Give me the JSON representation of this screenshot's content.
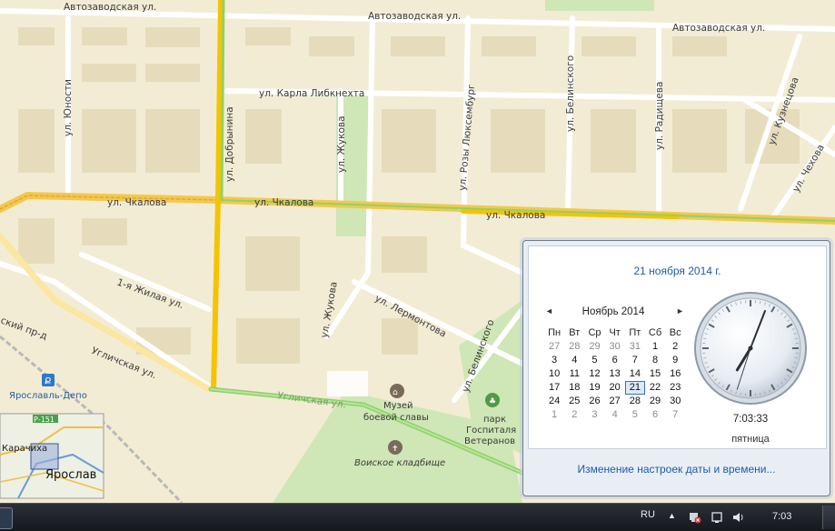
{
  "map": {
    "streets": {
      "avtozavodskaya_1": "Автозаводская ул.",
      "avtozavodskaya_2": "Автозаводская ул.",
      "avtozavodskaya_3": "Автозаводская ул.",
      "karla_libknekhta": "ул. Карла Либкнехта",
      "chkalova_1": "ул. Чкалова",
      "chkalova_2": "ул. Чкалова",
      "chkalova_3": "ул. Чкалова",
      "yunosti": "ул. Юности",
      "dobrynina": "ул. Добрынина",
      "zhukova_1": "ул. Жукова",
      "zhukova_2": "ул. Жукова",
      "rozy_lyuksemburg": "ул. Розы Люксембург",
      "belinskogo_1": "ул. Белинского",
      "belinskogo_2": "ул. Белинского",
      "radishcheva": "ул. Радищева",
      "kuznetsova": "ул. Кузнецова",
      "chekhova": "ул. Чехова",
      "zhilaya": "1-я Жилая ул.",
      "lermontova": "ул. Лермонтова",
      "uglichskaya_1": "Угличская ул.",
      "uglichskaya_2": "Угличская ул.",
      "yaroslavsky_pr": "ский пр-д"
    },
    "pois": {
      "station": "Ярославль-Депо",
      "museum_line1": "Музей",
      "museum_line2": "боевой славы",
      "park_line1": "парк",
      "park_line2": "Госпиталя",
      "park_line3": "Ветеранов",
      "cemetery": "Воиское кладбище"
    },
    "minimap": {
      "road_badge": "Р-151",
      "town": "Карачиха",
      "city": "Ярослав"
    }
  },
  "flyout": {
    "full_date": "21 ноября 2014 г.",
    "calendar": {
      "month_title": "Ноябрь 2014",
      "prev_label": "◄",
      "next_label": "►",
      "weekdays": [
        "Пн",
        "Вт",
        "Ср",
        "Чт",
        "Пт",
        "Сб",
        "Вс"
      ],
      "weeks": [
        [
          "27",
          "28",
          "29",
          "30",
          "31",
          "1",
          "2"
        ],
        [
          "3",
          "4",
          "5",
          "6",
          "7",
          "8",
          "9"
        ],
        [
          "10",
          "11",
          "12",
          "13",
          "14",
          "15",
          "16"
        ],
        [
          "17",
          "18",
          "19",
          "20",
          "21",
          "22",
          "23"
        ],
        [
          "24",
          "25",
          "26",
          "27",
          "28",
          "29",
          "30"
        ],
        [
          "1",
          "2",
          "3",
          "4",
          "5",
          "6",
          "7"
        ]
      ],
      "today": "21"
    },
    "clock": {
      "time_text": "7:03:33",
      "day_text": "пятница",
      "hour": 7,
      "minute": 3,
      "second": 33
    },
    "change_link": "Изменение настроек даты и времени..."
  },
  "taskbar": {
    "language": "RU",
    "tray_arrow": "▲",
    "time": "7:03",
    "icons": [
      "network-error-icon",
      "action-center-icon",
      "volume-icon"
    ]
  },
  "colors": {
    "map_bg": "#f3ecd5",
    "road_main": "#f4d24a",
    "road_green": "#8fd16c",
    "link_blue": "#1e5aa8"
  }
}
